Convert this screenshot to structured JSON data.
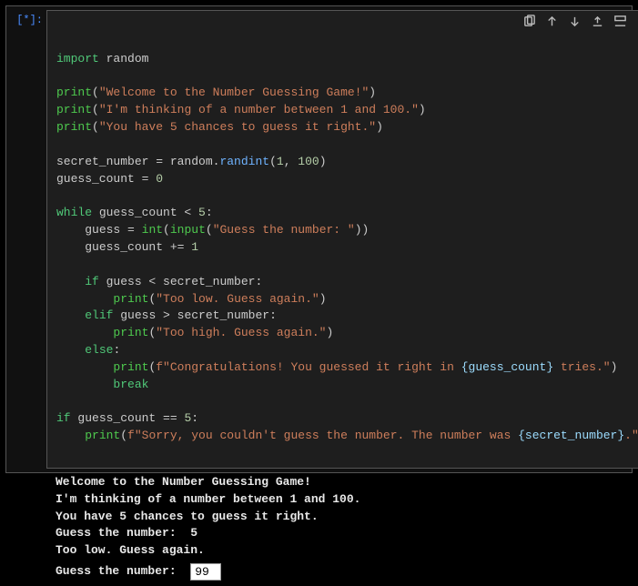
{
  "prompt": "[*]:",
  "toolbar_icons": [
    "copy-icon",
    "move-up-icon",
    "move-down-icon",
    "upload-icon",
    "insert-below-icon",
    "delete-icon"
  ],
  "code": {
    "l01_kw": "import",
    "l01_mod": "random",
    "l03_fn": "print",
    "l03_s": "\"Welcome to the Number Guessing Game!\"",
    "l04_fn": "print",
    "l04_s": "\"I'm thinking of a number between 1 and 100.\"",
    "l05_fn": "print",
    "l05_s": "\"You have 5 chances to guess it right.\"",
    "l07_v": "secret_number",
    "l07_eq": " = ",
    "l07_mod": "random",
    "l07_dot": ".",
    "l07_m": "randint",
    "l07_a": "1",
    "l07_b": "100",
    "l08_v": "guess_count",
    "l08_eq": " = ",
    "l08_n": "0",
    "l10_kw": "while",
    "l10_body": " guess_count < ",
    "l10_n": "5",
    "l10_c": ":",
    "l11_v": "guess",
    "l11_eq": " = ",
    "l11_int": "int",
    "l11_inp": "input",
    "l11_s": "\"Guess the number: \"",
    "l12_v": "guess_count",
    "l12_op": " += ",
    "l12_n": "1",
    "l14_kw": "if",
    "l14_body": " guess < secret_number:",
    "l15_fn": "print",
    "l15_s": "\"Too low. Guess again.\"",
    "l16_kw": "elif",
    "l16_body": " guess > secret_number:",
    "l17_fn": "print",
    "l17_s": "\"Too high. Guess again.\"",
    "l18_kw": "else",
    "l18_c": ":",
    "l19_fn": "print",
    "l19_pfx": "f\"Congratulations! You guessed it right in ",
    "l19_var": "{guess_count}",
    "l19_sfx": " tries.\"",
    "l20_kw": "break",
    "l22_kw": "if",
    "l22_body": " guess_count == ",
    "l22_n": "5",
    "l22_c": ":",
    "l23_fn": "print",
    "l23_pfx": "f\"Sorry, you couldn't guess the number. The number was ",
    "l23_var": "{secret_number}",
    "l23_sfx": ".\""
  },
  "output": {
    "line1": "Welcome to the Number Guessing Game!",
    "line2": "I'm thinking of a number between 1 and 100.",
    "line3": "You have 5 chances to guess it right.",
    "line4": "Guess the number:  5",
    "line5": "Too low. Guess again.",
    "prompt_label": "Guess the number:  ",
    "input_value": "99"
  }
}
